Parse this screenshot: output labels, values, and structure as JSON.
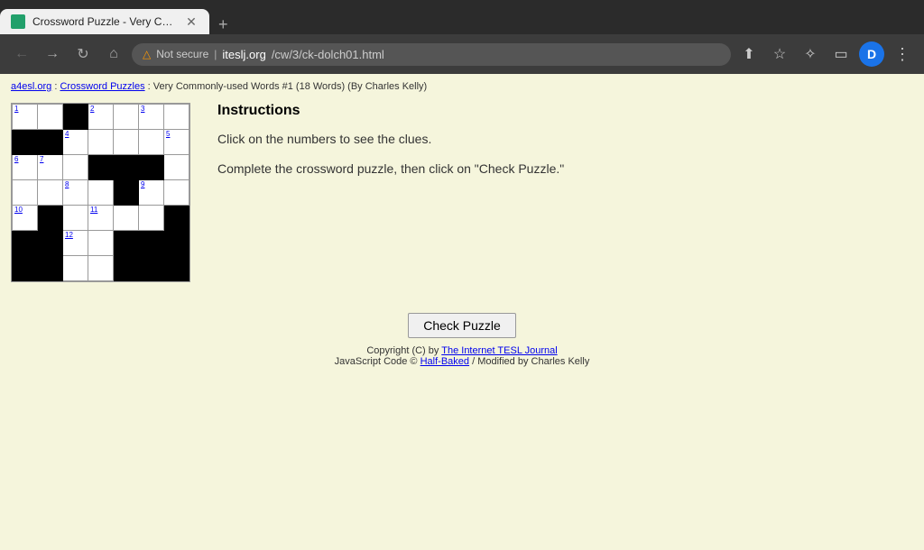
{
  "browser": {
    "tab_title": "Crossword Puzzle - Very Commo",
    "favicon_color": "#22a06b",
    "new_tab_label": "+",
    "url_warning": "Not secure",
    "url_domain": "iteslj.org",
    "url_path": "/cw/3/ck-dolch01.html",
    "profile_initial": "D"
  },
  "breadcrumb": {
    "site": "a4esl.org",
    "section": "Crossword Puzzles",
    "current": "Very Commonly-used Words #1 (18 Words) (By Charles Kelly)"
  },
  "instructions": {
    "heading": "Instructions",
    "line1": "Click on the numbers to see the clues.",
    "line2": "Complete the crossword puzzle, then click on \"Check Puzzle.\""
  },
  "grid": {
    "numbers": [
      1,
      2,
      3,
      4,
      5,
      6,
      7,
      8,
      9,
      10,
      11,
      12
    ]
  },
  "footer": {
    "check_button": "Check Puzzle",
    "copyright_text": "Copyright (C) by",
    "copyright_link": "The Internet TESL Journal",
    "js_text": "JavaScript Code ©",
    "js_link": "Half-Baked",
    "modified": "/ Modified by Charles Kelly"
  }
}
